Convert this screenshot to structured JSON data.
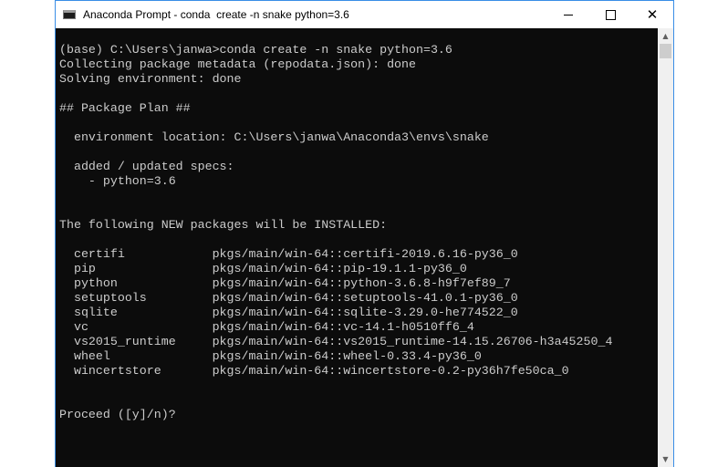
{
  "window": {
    "title": "Anaconda Prompt - conda  create -n snake python=3.6",
    "icon": "console-window-icon",
    "controls": {
      "minimize": "minimize-icon",
      "maximize": "maximize-icon",
      "close": "✕"
    }
  },
  "console": {
    "lines": [
      "(base) C:\\Users\\janwa>conda create -n snake python=3.6",
      "Collecting package metadata (repodata.json): done",
      "Solving environment: done",
      "",
      "## Package Plan ##",
      "",
      "  environment location: C:\\Users\\janwa\\Anaconda3\\envs\\snake",
      "",
      "  added / updated specs:",
      "    - python=3.6",
      "",
      "",
      "The following NEW packages will be INSTALLED:",
      "",
      "  certifi            pkgs/main/win-64::certifi-2019.6.16-py36_0",
      "  pip                pkgs/main/win-64::pip-19.1.1-py36_0",
      "  python             pkgs/main/win-64::python-3.6.8-h9f7ef89_7",
      "  setuptools         pkgs/main/win-64::setuptools-41.0.1-py36_0",
      "  sqlite             pkgs/main/win-64::sqlite-3.29.0-he774522_0",
      "  vc                 pkgs/main/win-64::vc-14.1-h0510ff6_4",
      "  vs2015_runtime     pkgs/main/win-64::vs2015_runtime-14.15.26706-h3a45250_4",
      "  wheel              pkgs/main/win-64::wheel-0.33.4-py36_0",
      "  wincertstore       pkgs/main/win-64::wincertstore-0.2-py36h7fe50ca_0",
      "",
      "",
      "Proceed ([y]/n)?"
    ]
  },
  "scrollbar": {
    "up": "▲",
    "down": "▼"
  },
  "colors": {
    "background": "#0c0c0c",
    "text": "#cccccc",
    "accent_border": "#3a8ee6"
  }
}
